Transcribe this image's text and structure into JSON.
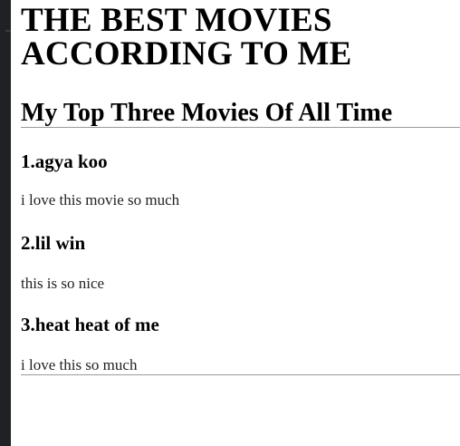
{
  "page": {
    "heading": "THE BEST MOVIES ACCORDING TO ME",
    "subheading": "My Top Three Movies Of All Time"
  },
  "movies": [
    {
      "title": "1.agya koo",
      "description": "i love this movie so much"
    },
    {
      "title": "2.lil win",
      "description": "this is so nice"
    },
    {
      "title": "3.heat heat of me",
      "description": "i love this so much"
    }
  ]
}
